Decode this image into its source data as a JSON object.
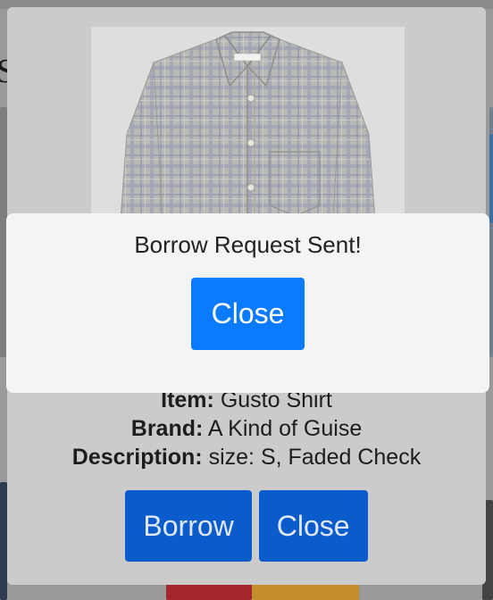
{
  "background": {
    "title_fragment": "S"
  },
  "item": {
    "image_icon": "plaid-shirt-photo",
    "item_label": "Item:",
    "item_value": "Gusto Shirt",
    "brand_label": "Brand:",
    "brand_value": "A Kind of Guise",
    "description_label": "Description:",
    "description_value": "size: S, Faded Check",
    "borrow_button": "Borrow",
    "close_button": "Close"
  },
  "alert": {
    "message": "Borrow Request Sent!",
    "close_button": "Close"
  },
  "colors": {
    "primary": "#0a7bff",
    "primary_dimmed": "#0a5ccc",
    "alert_bg": "#f4f4f4",
    "modal_bg_dimmed": "#cbcbcb"
  }
}
